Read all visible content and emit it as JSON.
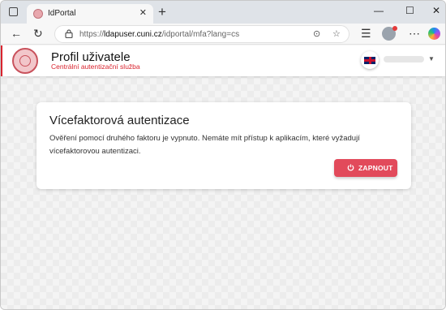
{
  "browser": {
    "tab_title": "IdPortal",
    "tab_close": "✕",
    "new_tab": "+",
    "url_prefix": "https://",
    "url_host": "ldapuser.cuni.cz",
    "url_path": "/idportal/mfa?lang=cs",
    "controls": {
      "minimize": "—",
      "maximize": "☐",
      "close": "✕"
    }
  },
  "header": {
    "title": "Profil uživatele",
    "subtitle": "Centrální autentizační služba",
    "language_flag": "uk-flag-icon"
  },
  "mfa": {
    "title": "Vícefaktorová autentizace",
    "description": "Ověření pomocí druhého faktoru je vypnuto. Nemáte mít přístup k aplikacím, které vyžadují vícefaktorovou autentizaci.",
    "button_label": "ZAPNOUT"
  },
  "colors": {
    "accent": "#d9232e",
    "button": "#e24a5b"
  }
}
